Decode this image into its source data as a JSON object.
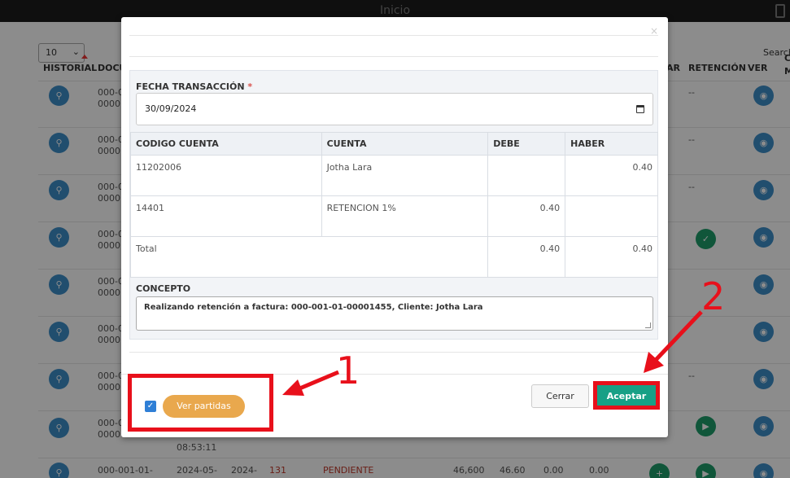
{
  "window": {
    "title": "Inicio"
  },
  "background": {
    "page_length": "10",
    "search_label": "Search",
    "headers": [
      "HISTORIAL",
      "DOCU",
      "AR",
      "RETENCIÓN",
      "VER",
      "C",
      "M"
    ],
    "rows": [
      {
        "doc": "000-0",
        "doc2": "0000",
        "ret": "--"
      },
      {
        "doc": "000-0",
        "doc2": "0000",
        "ret": "--"
      },
      {
        "doc": "000-0",
        "doc2": "0000",
        "ret": "--"
      },
      {
        "doc": "000-0",
        "doc2": "0000"
      },
      {
        "doc": "000-0",
        "doc2": "0000"
      },
      {
        "doc": "000-0",
        "doc2": "0000"
      },
      {
        "doc": "000-0",
        "doc2": "0000",
        "ret": "--"
      },
      {
        "doc": "000-0",
        "doc2": "0000",
        "time": "08:53:11"
      }
    ],
    "last_row": {
      "doc": "000-001-01-",
      "date1": "2024-05-",
      "date2": "2024-",
      "num": "131",
      "status": "PENDIENTE",
      "v1": "46,600",
      "v2": "46.60",
      "v3": "0.00",
      "v4": "0.00"
    }
  },
  "modal": {
    "close_icon": "×",
    "fecha_label": "FECHA TRANSACCIÓN",
    "required_mark": "*",
    "fecha_value": "30/09/2024",
    "table": {
      "headers": [
        "CODIGO CUENTA",
        "CUENTA",
        "DEBE",
        "HABER"
      ],
      "rows": [
        {
          "codigo": "11202006",
          "cuenta": "Jotha Lara",
          "debe": "",
          "haber": "0.40"
        },
        {
          "codigo": "14401",
          "cuenta": "RETENCION 1%",
          "debe": "0.40",
          "haber": ""
        }
      ],
      "total": {
        "label": "Total",
        "debe": "0.40",
        "haber": "0.40"
      }
    },
    "concepto_label": "CONCEPTO",
    "concepto_value": "Realizando retención a factura: 000-001-01-00001455, Cliente: Jotha Lara",
    "ver_partidas_label": "Ver partidas",
    "ver_partidas_checked": true,
    "cerrar_label": "Cerrar",
    "aceptar_label": "Aceptar"
  },
  "annotations": {
    "label_1": "1",
    "label_2": "2",
    "color": "#e8101b"
  }
}
